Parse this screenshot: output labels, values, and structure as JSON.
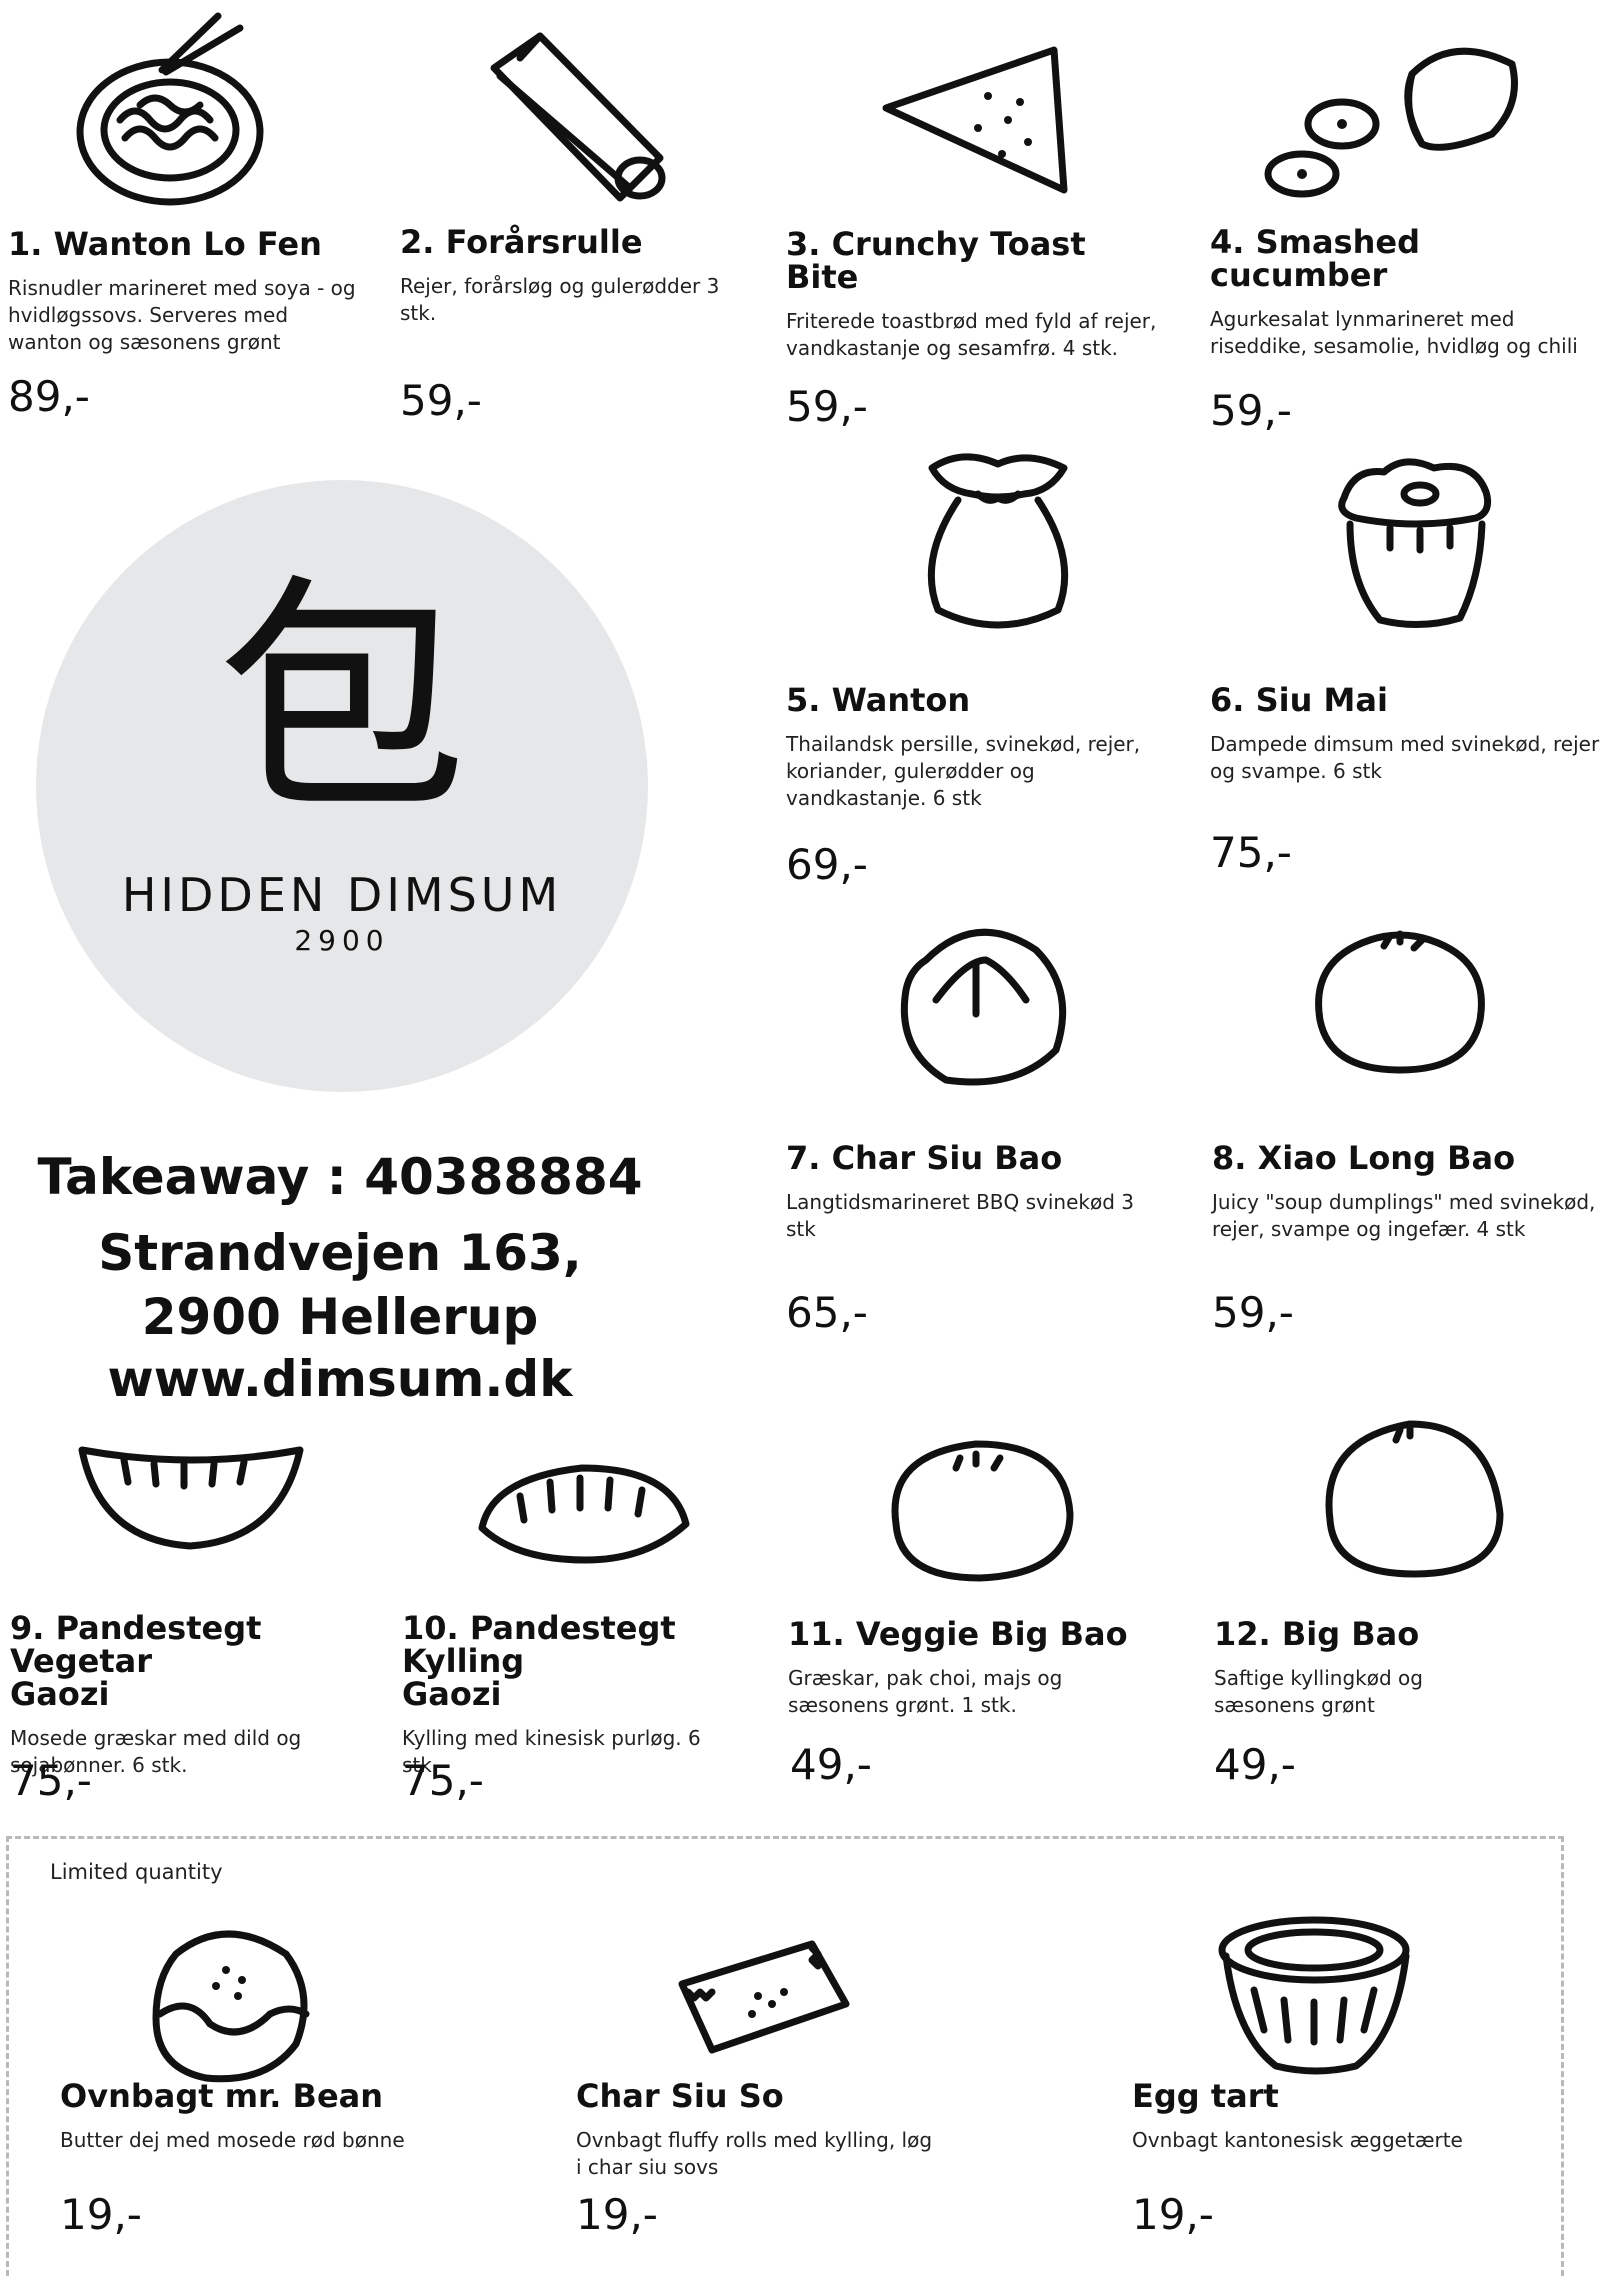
{
  "menu_items": [
    {
      "number": "1.",
      "name": "Wanton Lo Fen",
      "title": "1. Wanton Lo Fen",
      "description": "Risnudler marineret med soya - og hvidløgssovs. Serveres med wanton og sæsonens grønt",
      "price": "89,-",
      "icon": "noodle-bowl-icon"
    },
    {
      "number": "2.",
      "name": "Forårsrulle",
      "title": "2. Forårsrulle",
      "description": "Rejer, forårsløg og gulerødder 3 stk.",
      "price": "59,-",
      "icon": "spring-roll-icon"
    },
    {
      "number": "3.",
      "name": "Crunchy Toast Bite",
      "title": "3. Crunchy Toast Bite",
      "description": "Friterede toastbrød med fyld af rejer, vandkastanje og sesamfrø. 4 stk.",
      "price": "59,-",
      "icon": "toast-triangle-icon"
    },
    {
      "number": "4.",
      "name": "Smashed cucumber",
      "title": "4. Smashed cucumber",
      "description": "Agurkesalat lynmarineret med riseddike, sesamolie, hvidløg og chili",
      "price": "59,-",
      "icon": "cucumber-icon"
    },
    {
      "number": "5.",
      "name": "Wanton",
      "title": "5. Wanton",
      "description": "Thailandsk persille, svinekød, rejer, koriander, gulerødder og vandkastanje. 6 stk",
      "price": "69,-",
      "icon": "wanton-pouch-icon"
    },
    {
      "number": "6.",
      "name": "Siu Mai",
      "title": "6. Siu Mai",
      "description": "Dampede dimsum med svinekød, rejer og svampe. 6 stk",
      "price": "75,-",
      "icon": "siu-mai-icon"
    },
    {
      "number": "7.",
      "name": "Char Siu Bao",
      "title": "7. Char Siu Bao",
      "description": "Langtidsmarineret BBQ svinekød 3 stk",
      "price": "65,-",
      "icon": "char-siu-bao-icon"
    },
    {
      "number": "8.",
      "name": "Xiao Long Bao",
      "title": "8. Xiao Long Bao",
      "description": "Juicy \"soup dumplings\" med svinekød, rejer,  svampe og ingefær. 4 stk",
      "price": "59,-",
      "icon": "xiao-long-bao-icon"
    },
    {
      "number": "9.",
      "name": "Pandestegt Vegetar Gaozi",
      "title": "9. Pandestegt Vegetar Gaozi",
      "description": "Mosede græskar med dild og sojabønner. 6 stk.",
      "price": "75,-",
      "icon": "gaozi-dumpling-icon"
    },
    {
      "number": "10.",
      "name": "Pandestegt Kylling Gaozi",
      "title": "10. Pandestegt Kylling Gaozi",
      "description": "Kylling med kinesisk purløg. 6 stk",
      "price": "75,-",
      "icon": "gaozi-dumpling-icon"
    },
    {
      "number": "11.",
      "name": "Veggie Big Bao",
      "title": "11. Veggie Big Bao",
      "description": "Græskar, pak choi, majs og sæsonens grønt. 1 stk.",
      "price": "49,-",
      "icon": "big-bao-icon"
    },
    {
      "number": "12.",
      "name": "Big Bao",
      "title": "12. Big Bao",
      "description": "Saftige kyllingkød og sæsonens grønt",
      "price": "49,-",
      "icon": "big-bao-icon"
    }
  ],
  "brand": {
    "name": "HIDDEN DIMSUM",
    "subtitle": "2900",
    "logo_glyph": "包",
    "circle_color": "#e6e7e8"
  },
  "contact": {
    "takeaway": "Takeaway : 40388884",
    "street": "Strandvejen 163,",
    "city": "2900 Hellerup",
    "website": "www.dimsum.dk"
  },
  "limited": {
    "label": "Limited quantity",
    "items": [
      {
        "name": "Ovnbagt mr. Bean",
        "description": "Butter dej med mosede rød bønne",
        "price": "19,-",
        "icon": "red-bean-bun-icon"
      },
      {
        "name": "Char Siu So",
        "description": "Ovnbagt fluffy rolls med kylling, løg i char siu sovs",
        "price": "19,-",
        "icon": "pastry-roll-icon"
      },
      {
        "name": "Egg tart",
        "description": "Ovnbagt kantonesisk æggetærte",
        "price": "19,-",
        "icon": "egg-tart-icon"
      }
    ]
  }
}
